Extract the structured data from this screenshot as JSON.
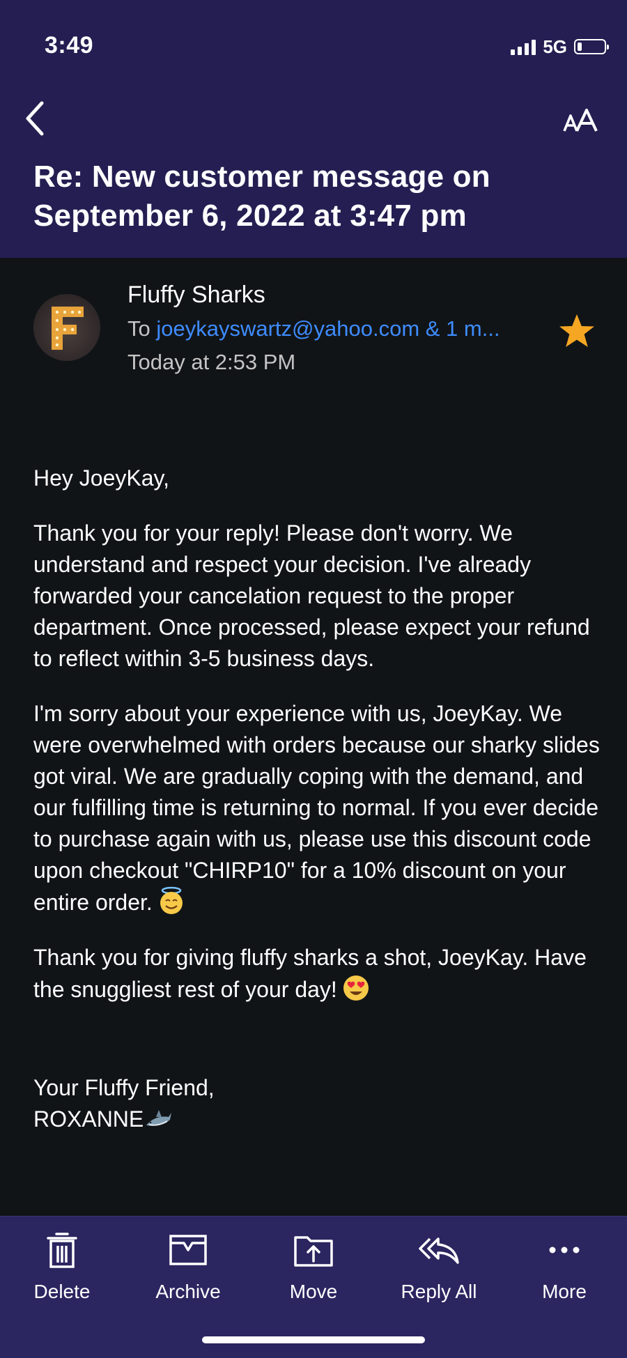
{
  "status_bar": {
    "time": "3:49",
    "network": "5G"
  },
  "email": {
    "subject": "Re: New customer message on September 6, 2022 at 3:47 pm",
    "sender_name": "Fluffy Sharks",
    "avatar_letter": "F",
    "to_prefix": "To",
    "to_address": "joeykayswartz@yahoo.com & 1 m...",
    "date": "Today at 2:53 PM",
    "starred": true,
    "body": {
      "greeting": "Hey JoeyKay,",
      "p1": "Thank you for your reply! Please don't worry. We understand and respect your decision. I've already forwarded your cancelation request to the proper department. Once processed, please expect your refund to reflect within 3-5 business days.",
      "p2": "I'm sorry about your experience with us, JoeyKay. We were overwhelmed with orders because our sharky slides got viral. We are gradually coping with the demand, and our fulfilling time is returning to normal. If you ever decide to purchase again with us, please use this discount code upon checkout \"CHIRP10\" for a 10% discount on your entire order.",
      "p3": "Thank you for giving fluffy sharks a shot, JoeyKay. Have the snuggliest rest of your day!",
      "closing": "Your Fluffy Friend,",
      "signature": "ROXANNE"
    }
  },
  "toolbar": {
    "delete": "Delete",
    "archive": "Archive",
    "move": "Move",
    "reply_all": "Reply All",
    "more": "More"
  },
  "colors": {
    "header_bg": "#241e52",
    "toolbar_bg": "#2b2560",
    "body_bg": "#111417",
    "link": "#3e8cff",
    "star": "#f5a623"
  },
  "icons": [
    "back-chevron-icon",
    "text-size-icon",
    "star-icon",
    "trash-icon",
    "archive-icon",
    "move-icon",
    "reply-all-icon",
    "more-dots-icon",
    "halo-smile-emoji",
    "heart-eyes-emoji",
    "shark-emoji"
  ]
}
